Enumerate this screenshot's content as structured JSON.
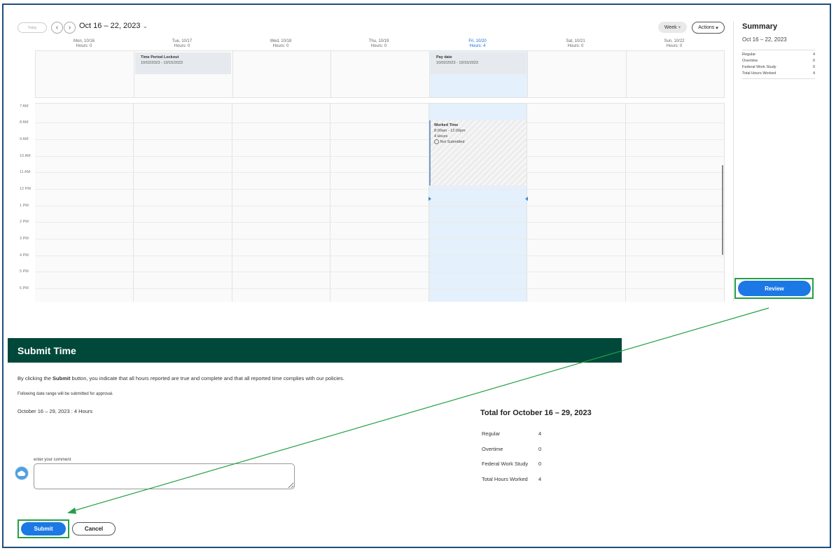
{
  "calendar": {
    "today_label": "Today",
    "prev_icon": "chevron-left-icon",
    "next_icon": "chevron-right-icon",
    "date_range": "Oct 16 – 22, 2023",
    "range_dropdown_icon": "chevron-down-icon",
    "week_label": "Week",
    "week_caret": "▾",
    "actions_label": "Actions",
    "actions_caret": "▾",
    "days": [
      {
        "label": "Mon, 10/16",
        "hours": "Hours: 0"
      },
      {
        "label": "Tue, 10/17",
        "hours": "Hours: 0"
      },
      {
        "label": "Wed, 10/18",
        "hours": "Hours: 0"
      },
      {
        "label": "Thu, 10/19",
        "hours": "Hours: 0"
      },
      {
        "label": "Fri, 10/20",
        "hours": "Hours: 4"
      },
      {
        "label": "Sat, 10/21",
        "hours": "Hours: 0"
      },
      {
        "label": "Sun, 10/22",
        "hours": "Hours: 0"
      }
    ],
    "active_day_color": "#1a6bd6",
    "all_day_events": [
      {
        "title": "Time Period Lockout",
        "range": "10/02/2023 - 10/15/2023"
      },
      {
        "title": "Pay date",
        "range": "10/02/2023 - 10/15/2023"
      }
    ],
    "times": [
      "7 AM",
      "8 AM",
      "9 AM",
      "10 AM",
      "11 AM",
      "12 PM",
      "1 PM",
      "2 PM",
      "3 PM",
      "4 PM",
      "5 PM",
      "6 PM"
    ],
    "worked_event": {
      "title": "Worked Time",
      "time": "8:00am - 12:00pm",
      "hours": "4 Hours",
      "status": "Not Submitted",
      "status_icon": "clock-icon"
    }
  },
  "summary": {
    "title": "Summary",
    "range": "Oct 16 – 22, 2023",
    "rows": [
      {
        "label": "Regular",
        "value": "4"
      },
      {
        "label": "Overtime",
        "value": "0"
      },
      {
        "label": "Federal Work Study",
        "value": "0"
      },
      {
        "label": "Total Hours Worked",
        "value": "4"
      }
    ],
    "review_label": "Review"
  },
  "submit": {
    "title": "Submit Time",
    "notice_pre": "By clicking the ",
    "notice_bold": "Submit",
    "notice_post": " button, you indicate that all hours reported are true and complete and that all reported time complies with our policies.",
    "range_note": "Following date range will be submitted for approval.",
    "range_line": "October 16 – 29, 2023 : 4 Hours",
    "total_title": "Total for October 16 – 29, 2023",
    "totals": [
      {
        "label": "Regular",
        "value": "4"
      },
      {
        "label": "Overtime",
        "value": "0"
      },
      {
        "label": "Federal Work Study",
        "value": "0"
      },
      {
        "label": "Total Hours Worked",
        "value": "4"
      }
    ],
    "comment_label": "enter your comment",
    "comment_value": "",
    "avatar_icon": "cloud-avatar-icon",
    "submit_label": "Submit",
    "cancel_label": "Cancel"
  },
  "colors": {
    "header_green": "#00483a",
    "primary_blue": "#1c78e4",
    "highlight_green": "#22a045",
    "friday_tint": "#e4f0fb"
  }
}
